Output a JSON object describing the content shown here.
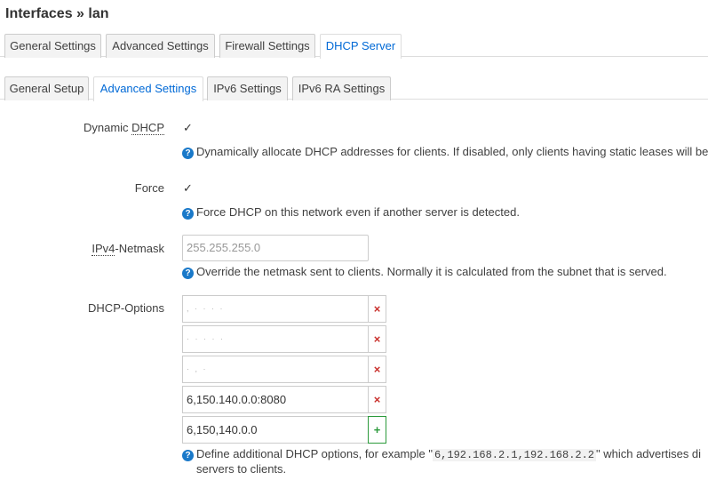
{
  "page": {
    "title": "Interfaces » lan"
  },
  "main_tabs": [
    {
      "label": "General Settings"
    },
    {
      "label": "Advanced Settings"
    },
    {
      "label": "Firewall Settings"
    },
    {
      "label": "DHCP Server"
    }
  ],
  "sub_tabs": [
    {
      "label": "General Setup"
    },
    {
      "label": "Advanced Settings"
    },
    {
      "label": "IPv6 Settings"
    },
    {
      "label": "IPv6 RA Settings"
    }
  ],
  "fields": {
    "dynamic_dhcp": {
      "label_prefix": "Dynamic ",
      "label_abbr": "DHCP",
      "checked": true,
      "check_glyph": "✓",
      "help": "Dynamically allocate DHCP addresses for clients. If disabled, only clients having static leases will be"
    },
    "force": {
      "label": "Force",
      "checked": true,
      "check_glyph": "✓",
      "help": "Force DHCP on this network even if another server is detected."
    },
    "netmask": {
      "label_abbr": "IPv4",
      "label_suffix": "-Netmask",
      "placeholder": "255.255.255.0",
      "help": "Override the netmask sent to clients. Normally it is calculated from the subnet that is served."
    },
    "dhcp_options": {
      "label": "DHCP-Options",
      "values": [
        {
          "value": ",  ·  ·  ·  ·"
        },
        {
          "value": "·  ·  ·  ·  ·"
        },
        {
          "value": "· ,  ·"
        },
        {
          "value": "6,150.140.0.0:8080"
        },
        {
          "value": "6,150,140.0.0"
        }
      ],
      "remove_glyph": "×",
      "add_glyph": "+",
      "help_pre": "Define additional DHCP options, for example \"",
      "help_code": "6,192.168.2.1,192.168.2.2",
      "help_post": "\" which advertises di",
      "help_line2": "servers to clients."
    }
  },
  "icons": {
    "help": "question-circle",
    "help_glyph": "?"
  },
  "colors": {
    "accent": "#0069d6",
    "help_icon": "#1a79c9",
    "remove": "#c9302c",
    "add": "#2b9a3b"
  }
}
